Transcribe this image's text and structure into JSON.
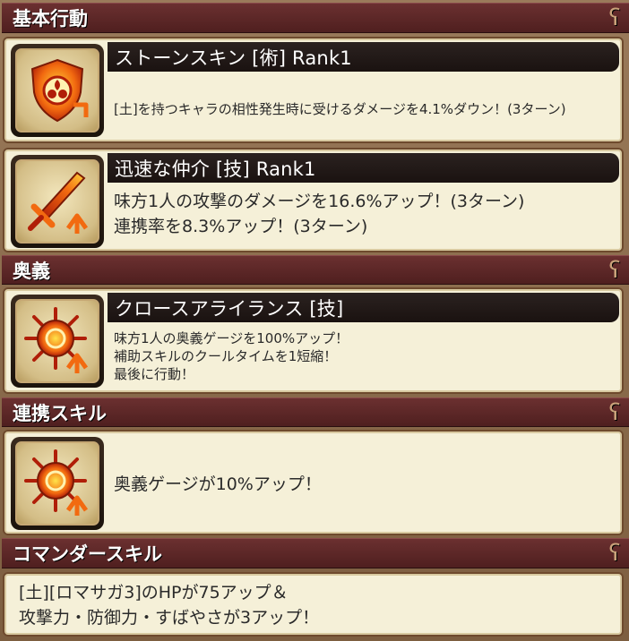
{
  "sections": {
    "basic": {
      "label": "基本行動"
    },
    "ougi": {
      "label": "奥義"
    },
    "renkei": {
      "label": "連携スキル"
    },
    "commander": {
      "label": "コマンダースキル"
    }
  },
  "skills": {
    "stone_skin": {
      "title": "ストーンスキン [術]  Rank1",
      "icon": "shield-flame-icon",
      "lines": [
        "[土]を持つキャラの相性発生時に受けるダメージを4.1%ダウン！(3ターン)"
      ]
    },
    "jinsoku": {
      "title": "迅速な仲介 [技]  Rank1",
      "icon": "sword-up-icon",
      "lines": [
        "味方1人の攻撃のダメージを16.6%アップ！(3ターン)",
        "連携率を8.3%アップ！(3ターン)"
      ]
    },
    "cross_alliance": {
      "title": "クロースアライランス [技]",
      "icon": "burst-up-icon",
      "lines": [
        "味方1人の奥義ゲージを100%アップ！",
        "補助スキルのクールタイムを1短縮！",
        "最後に行動！"
      ]
    },
    "renkei_skill": {
      "icon": "burst-up-icon",
      "lines": [
        "奥義ゲージが10%アップ！"
      ]
    },
    "commander_skill": {
      "lines": [
        "[土][ロマサガ3]のHPが75アップ＆",
        "攻撃力・防御力・すばやさが3アップ！"
      ]
    }
  },
  "colors": {
    "header": "#5a2626",
    "card": "#f5f0d8",
    "title_bar": "#221a18",
    "icon_orange": "#f06a10"
  }
}
